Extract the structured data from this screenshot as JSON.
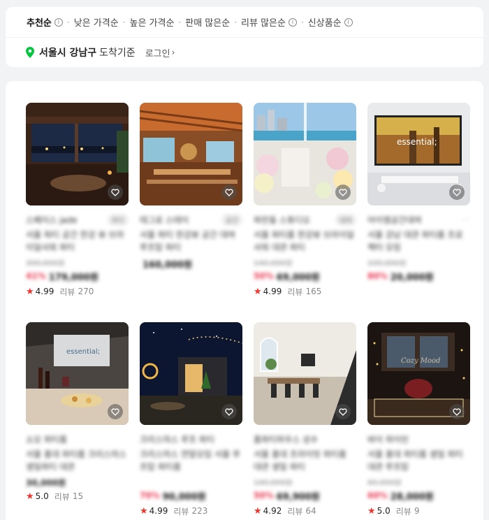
{
  "sort": {
    "items": [
      {
        "label": "추천순",
        "info": true,
        "active": true
      },
      {
        "label": "낮은 가격순",
        "info": false,
        "active": false
      },
      {
        "label": "높은 가격순",
        "info": false,
        "active": false
      },
      {
        "label": "판매 많은순",
        "info": false,
        "active": false
      },
      {
        "label": "리뷰 많은순",
        "info": true,
        "active": false
      },
      {
        "label": "신상품순",
        "info": true,
        "active": false
      }
    ],
    "separator": "·"
  },
  "location": {
    "text": "서울시 강남구",
    "suffix": "도착기준",
    "login_label": "로그인",
    "pin_color": "#00c73c"
  },
  "review_label": "리뷰",
  "products": [
    {
      "shop": "스페이스 jade",
      "badge": "파티",
      "title": "서울 파티 공간 한강 뷰 브라이덜샤워 파티",
      "orig": "300,000원",
      "discount": "41%",
      "price": "179,000원",
      "rating": "4.99",
      "reviews": "270"
    },
    {
      "shop": "테그로 스테이",
      "badge": "공간",
      "title": "서울 파티 한강뷰 공간 대여 루프탑 파티",
      "orig": "",
      "discount": "",
      "price": "160,000원",
      "rating": "",
      "reviews": ""
    },
    {
      "shop": "파란들 스튜디오",
      "badge": "대여",
      "title": "서울 파티룸 한강뷰 브라이덜 샤워 대관 파티",
      "orig": "140,000원",
      "discount": "50%",
      "price": "69,000원",
      "rating": "4.99",
      "reviews": "165"
    },
    {
      "shop": "아이엠공간대여",
      "badge": "",
      "title": "서울 강남 대관 파티룸 프로젝터 모임",
      "orig": "100,000원",
      "discount": "80%",
      "price": "20,000원",
      "rating": "",
      "reviews": ""
    },
    {
      "shop": "소모 파티룸",
      "badge": "",
      "title": "서울 홍대 파티룸 크리스마스 생일파티 대관",
      "orig": "30,000원",
      "discount": "",
      "price": "",
      "rating": "5.0",
      "reviews": "15"
    },
    {
      "shop": "크리스마스 루프 파티",
      "badge": "",
      "title": "크리스마스 연말모임 서울 루프탑 파티룸",
      "orig": "",
      "discount": "70%",
      "price": "90,000원",
      "rating": "4.99",
      "reviews": "223"
    },
    {
      "shop": "홈파티하우스 성수",
      "badge": "",
      "title": "서울 홍대 프라이빗 파티룸 대관 생일 파티",
      "orig": "140,000원",
      "discount": "50%",
      "price": "69,900원",
      "rating": "4.92",
      "reviews": "64"
    },
    {
      "shop": "바이 하이빈",
      "badge": "",
      "title": "서울 홍대 파티룸 생일 파티 대관 루프탑",
      "orig": "60,000원",
      "discount": "60%",
      "price": "28,000원",
      "rating": "5.0",
      "reviews": "9"
    }
  ]
}
